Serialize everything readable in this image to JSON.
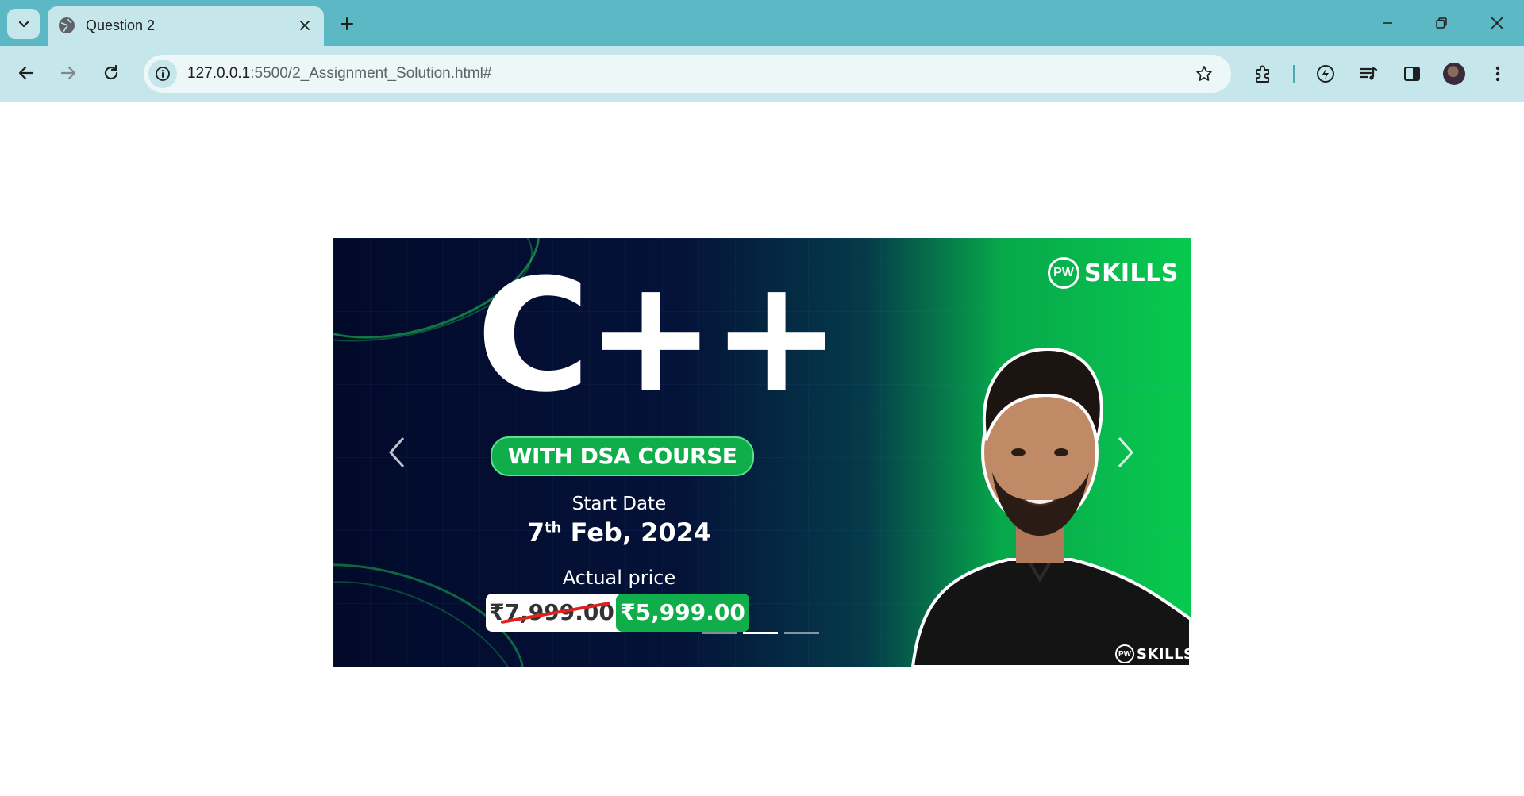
{
  "browser": {
    "tab": {
      "title": "Question 2"
    },
    "address": {
      "host": "127.0.0.1",
      "rest": ":5500/2_Assignment_Solution.html#"
    }
  },
  "carousel": {
    "slide": {
      "heading": "C++",
      "badge": "WITH DSA COURSE",
      "start_label": "Start Date",
      "date_day": "7",
      "date_suffix": "th",
      "date_rest": " Feb, 2024",
      "price_label": "Actual price",
      "old_price": "₹7,999.00",
      "new_price": "₹5,999.00",
      "brand": "SKILLS",
      "brand_mark": "PW",
      "watermark_brand": "SKILLS"
    },
    "active_index": 1,
    "slide_count": 3
  },
  "colors": {
    "chrome_tabbar": "#5bb8c4",
    "chrome_toolbar": "#c5e6ea",
    "accent_green": "#0fae4a"
  },
  "icons": [
    "tab-list-icon",
    "globe-icon",
    "close-icon",
    "plus-icon",
    "minimize-icon",
    "restore-icon",
    "back-icon",
    "forward-icon",
    "reload-icon",
    "info-icon",
    "star-icon",
    "extensions-icon",
    "performance-icon",
    "media-icon",
    "side-panel-icon",
    "menu-icon",
    "chevron-left-icon",
    "chevron-right-icon"
  ]
}
